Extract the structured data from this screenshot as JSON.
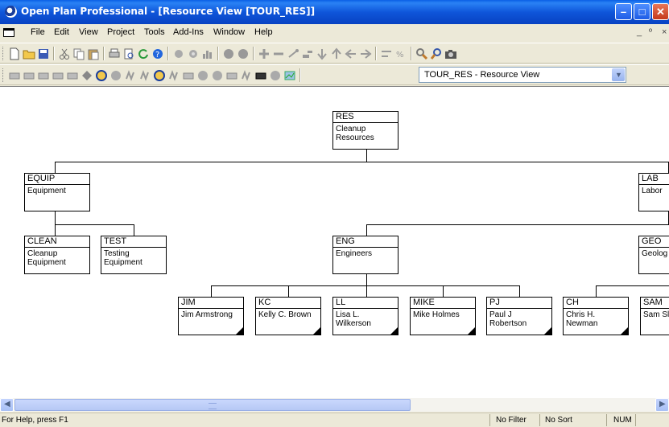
{
  "window": {
    "title": "Open Plan Professional - [Resource View [TOUR_RES]]"
  },
  "menu": {
    "items": [
      "File",
      "Edit",
      "View",
      "Project",
      "Tools",
      "Add-Ins",
      "Window",
      "Help"
    ],
    "mdi_controls": [
      "_",
      "º",
      "×"
    ]
  },
  "toolbar": {
    "view_selector": "TOUR_RES - Resource View"
  },
  "tree": {
    "root": {
      "code": "RES",
      "desc": "Cleanup\nResources"
    },
    "equip": {
      "code": "EQUIP",
      "desc": "Equipment"
    },
    "lab": {
      "code": "LAB",
      "desc": "Labor"
    },
    "clean": {
      "code": "CLEAN",
      "desc": "Cleanup\nEquipment"
    },
    "test": {
      "code": "TEST",
      "desc": "Testing\nEquipment"
    },
    "eng": {
      "code": "ENG",
      "desc": "Engineers"
    },
    "geo": {
      "code": "GEO",
      "desc": "Geolog"
    },
    "jim": {
      "code": "JIM",
      "desc": "Jim Armstrong"
    },
    "kc": {
      "code": "KC",
      "desc": "Kelly C. Brown"
    },
    "ll": {
      "code": "LL",
      "desc": "Lisa L.\nWilkerson"
    },
    "mike": {
      "code": "MIKE",
      "desc": "Mike Holmes"
    },
    "pj": {
      "code": "PJ",
      "desc": "Paul J\nRobertson"
    },
    "ch": {
      "code": "CH",
      "desc": "Chris H.\nNewman"
    },
    "sam": {
      "code": "SAM",
      "desc": "Sam Sl"
    }
  },
  "status": {
    "help": "For Help, press F1",
    "filter": "No Filter",
    "sort": "No Sort",
    "num": "NUM"
  },
  "colors": {
    "title_bar": "#0A5FE6",
    "chrome": "#ECE9D8",
    "canvas": "#FFFFFF"
  }
}
